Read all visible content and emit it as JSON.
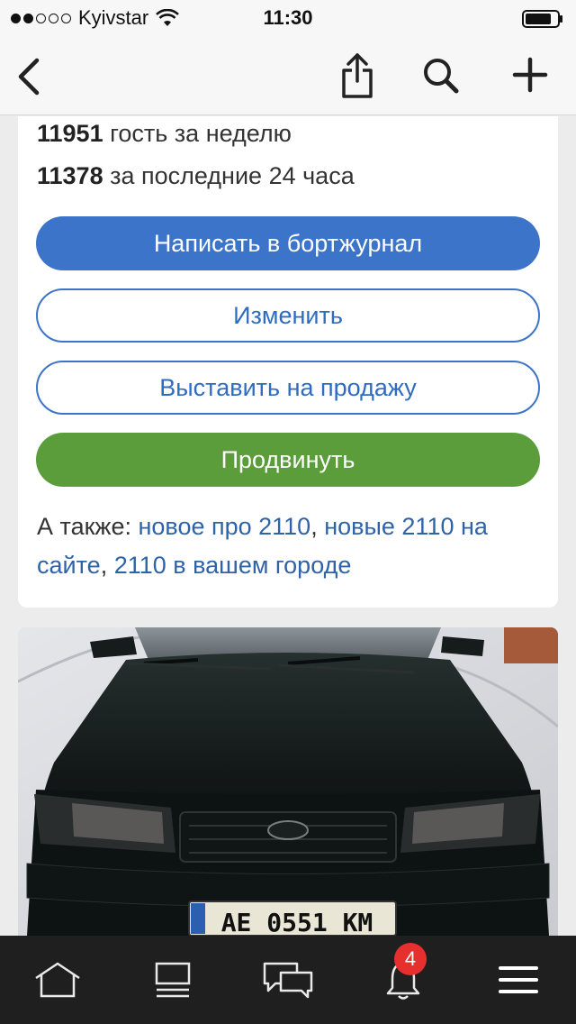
{
  "status_bar": {
    "carrier": "Kyivstar",
    "time": "11:30"
  },
  "nav": {
    "icons": [
      "chevron-left-icon",
      "share-icon",
      "search-icon",
      "plus-icon"
    ]
  },
  "stats": {
    "week_count": "11951",
    "week_label": " гость за неделю",
    "day_count": "11378",
    "day_label": " за последние 24 часа"
  },
  "actions": {
    "write_label": "Написать в бортжурнал",
    "edit_label": "Изменить",
    "sell_label": "Выставить на продажу",
    "promote_label": "Продвинуть"
  },
  "also": {
    "prefix": "А также: ",
    "links": [
      "новое про 2110",
      "новые 2110 на сайте",
      "2110 в вашем городе"
    ],
    "separator": ", "
  },
  "photo": {
    "plate": "AE 0551 KM"
  },
  "tab_bar": {
    "items": [
      "home-icon",
      "feed-icon",
      "messages-icon",
      "notifications-icon",
      "menu-icon"
    ],
    "notification_count": "4"
  },
  "colors": {
    "primary": "#3b74c9",
    "promote": "#5a9d3a",
    "link": "#2f63a8",
    "badge": "#e5302e",
    "tab_bar_bg": "#1f1f1f"
  }
}
